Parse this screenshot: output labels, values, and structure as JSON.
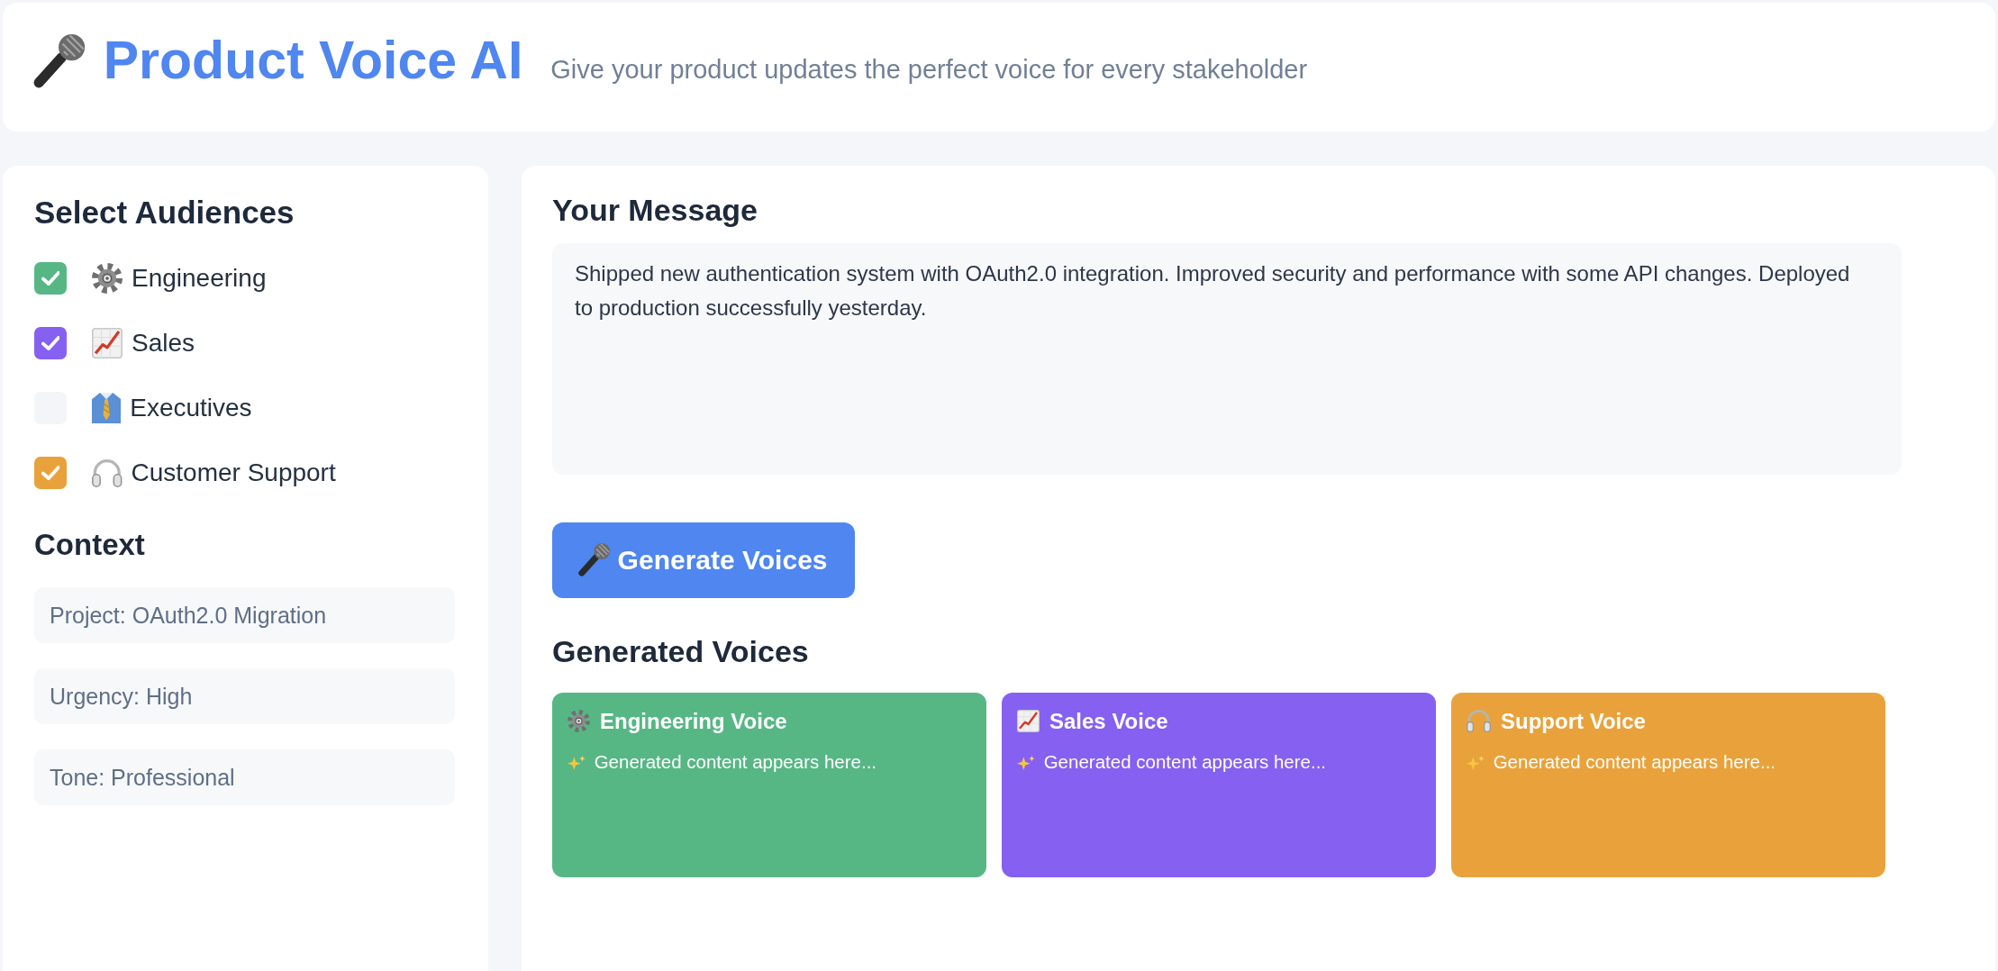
{
  "header": {
    "title": "Product Voice AI",
    "subtitle": "Give your product updates the perfect voice for every stakeholder"
  },
  "sidebar": {
    "audiences_title": "Select Audiences",
    "audiences": [
      {
        "label": "Engineering",
        "checked": true,
        "color": "#56b785"
      },
      {
        "label": "Sales",
        "checked": true,
        "color": "#8660f0"
      },
      {
        "label": "Executives",
        "checked": false
      },
      {
        "label": "Customer Support",
        "checked": true,
        "color": "#e9a23b"
      }
    ],
    "context_title": "Context",
    "context_items": [
      "Project: OAuth2.0 Migration",
      "Urgency: High",
      "Tone: Professional"
    ]
  },
  "main": {
    "message_title": "Your Message",
    "message": "Shipped new authentication system with OAuth2.0 integration. Improved security and performance with some API changes. Deployed to production successfully yesterday.",
    "generate_button": "Generate Voices",
    "voices_title": "Generated Voices",
    "voices": [
      {
        "title": "Engineering Voice",
        "content": "Generated content appears here...",
        "color": "#56b785"
      },
      {
        "title": "Sales Voice",
        "content": "Generated content appears here...",
        "color": "#8660f0"
      },
      {
        "title": "Support Voice",
        "content": "Generated content appears here...",
        "color": "#e9a23b"
      }
    ]
  }
}
